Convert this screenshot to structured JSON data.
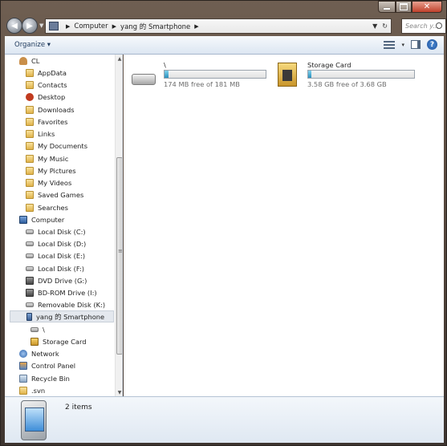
{
  "window": {
    "caption_buttons": [
      "minimize",
      "maximize",
      "close"
    ]
  },
  "nav": {
    "back_icon": "back-arrow-icon",
    "forward_icon": "forward-arrow-icon"
  },
  "address": {
    "crumbs": [
      "Computer",
      "yang 的 Smartphone"
    ]
  },
  "search": {
    "placeholder": "Search y..."
  },
  "toolbar": {
    "organize_label": "Organize",
    "organize_arrow": "▾"
  },
  "sidebar": {
    "items": [
      {
        "label": "CL",
        "icon": "user-folder-icon"
      },
      {
        "label": "AppData",
        "icon": "folder-icon"
      },
      {
        "label": "Contacts",
        "icon": "contacts-folder-icon"
      },
      {
        "label": "Desktop",
        "icon": "desktop-icon"
      },
      {
        "label": "Downloads",
        "icon": "downloads-folder-icon"
      },
      {
        "label": "Favorites",
        "icon": "favorites-folder-icon"
      },
      {
        "label": "Links",
        "icon": "links-folder-icon"
      },
      {
        "label": "My Documents",
        "icon": "documents-folder-icon"
      },
      {
        "label": "My Music",
        "icon": "music-folder-icon"
      },
      {
        "label": "My Pictures",
        "icon": "pictures-folder-icon"
      },
      {
        "label": "My Videos",
        "icon": "videos-folder-icon"
      },
      {
        "label": "Saved Games",
        "icon": "saved-games-folder-icon"
      },
      {
        "label": "Searches",
        "icon": "searches-folder-icon"
      },
      {
        "label": "Computer",
        "icon": "computer-icon"
      },
      {
        "label": "Local Disk (C:)",
        "icon": "local-disk-icon"
      },
      {
        "label": "Local Disk (D:)",
        "icon": "local-disk-icon"
      },
      {
        "label": "Local Disk (E:)",
        "icon": "local-disk-icon"
      },
      {
        "label": "Local Disk (F:)",
        "icon": "local-disk-icon"
      },
      {
        "label": "DVD Drive (G:)",
        "icon": "dvd-drive-icon"
      },
      {
        "label": "BD-ROM Drive (I:)",
        "icon": "bd-rom-drive-icon"
      },
      {
        "label": "Removable Disk (K:)",
        "icon": "removable-disk-icon"
      },
      {
        "label": "yang 的 Smartphone",
        "icon": "smartphone-icon"
      },
      {
        "label": "\\",
        "icon": "drive-icon"
      },
      {
        "label": "Storage Card",
        "icon": "storage-card-icon"
      },
      {
        "label": "Network",
        "icon": "network-icon"
      },
      {
        "label": "Control Panel",
        "icon": "control-panel-icon"
      },
      {
        "label": "Recycle Bin",
        "icon": "recycle-bin-icon"
      },
      {
        "label": ".svn",
        "icon": "folder-icon"
      }
    ]
  },
  "content": {
    "drives": [
      {
        "name": "\\",
        "free_text": "174 MB free of 181 MB",
        "used_fraction": 0.04,
        "icon": "hard-drive-icon"
      },
      {
        "name": "Storage Card",
        "free_text": "3.58 GB free of 3.68 GB",
        "used_fraction": 0.03,
        "icon": "storage-card-icon"
      }
    ]
  },
  "details": {
    "item_count": "2 items",
    "icon": "smartphone-device-icon"
  }
}
